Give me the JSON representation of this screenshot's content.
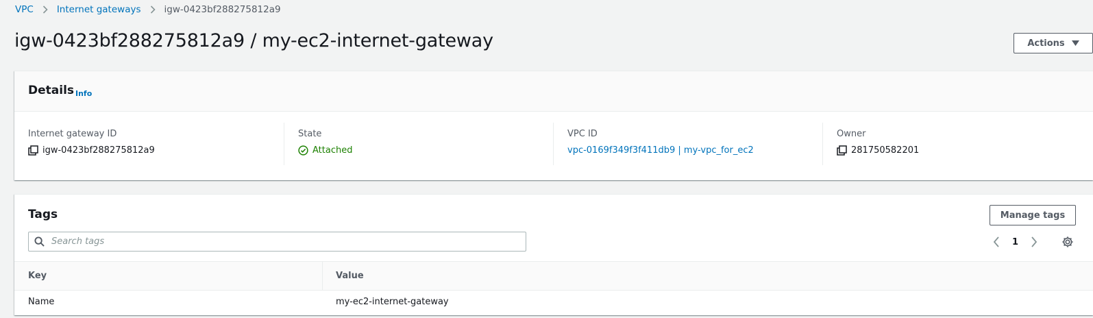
{
  "breadcrumb": {
    "items": [
      "VPC",
      "Internet gateways"
    ],
    "current": "igw-0423bf288275812a9"
  },
  "page_title": "igw-0423bf288275812a9 / my-ec2-internet-gateway",
  "actions_label": "Actions",
  "details": {
    "heading": "Details",
    "info_label": "Info",
    "fields": [
      {
        "label": "Internet gateway ID",
        "value": "igw-0423bf288275812a9",
        "icon": "copy-icon"
      },
      {
        "label": "State",
        "value": "Attached",
        "icon": "check-circle-icon"
      },
      {
        "label": "VPC ID",
        "value": "vpc-0169f349f3f411db9 | my-vpc_for_ec2"
      },
      {
        "label": "Owner",
        "value": "281750582201",
        "icon": "copy-icon"
      }
    ]
  },
  "tags": {
    "heading": "Tags",
    "manage_label": "Manage tags",
    "search_placeholder": "Search tags",
    "page_number": "1",
    "columns": [
      "Key",
      "Value"
    ],
    "rows": [
      {
        "key": "Name",
        "value": "my-ec2-internet-gateway"
      }
    ]
  },
  "colors": {
    "link": "#0073bb",
    "success": "#1d8102",
    "text": "#16191f",
    "muted": "#545b64",
    "background": "#f2f3f3"
  }
}
